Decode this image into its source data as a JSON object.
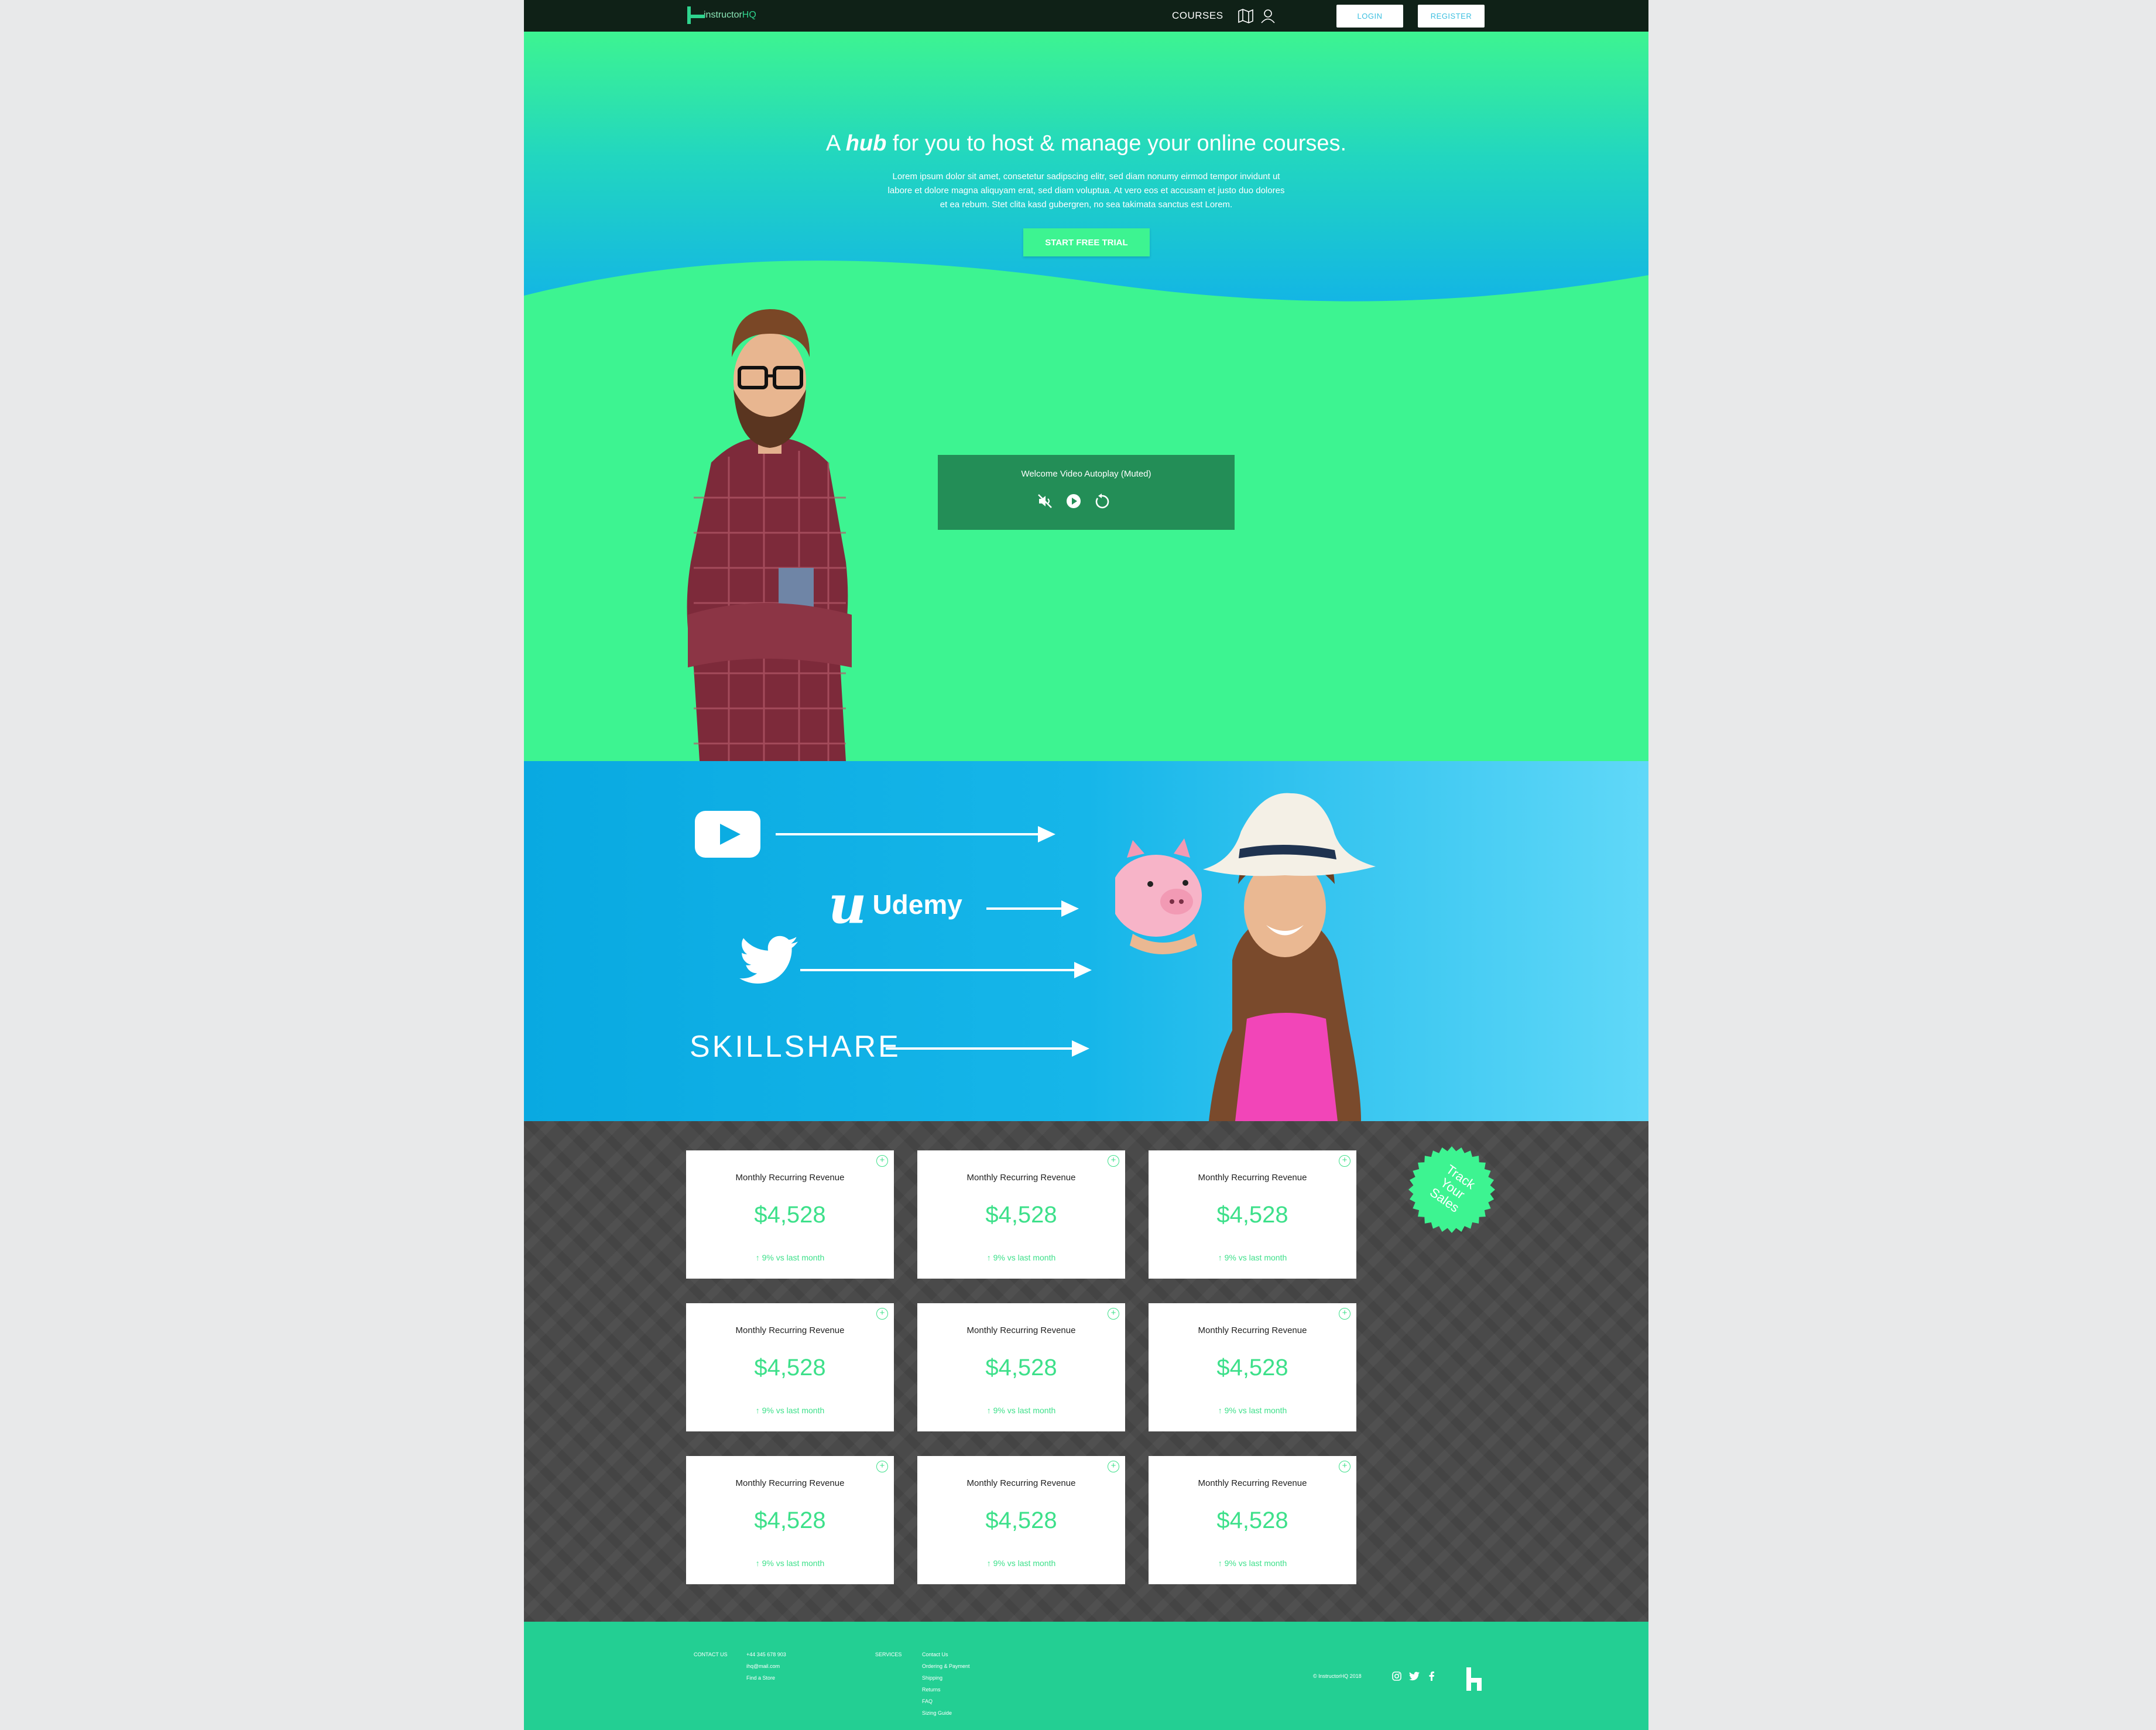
{
  "nav": {
    "logo_prefix": "instructor",
    "logo_suffix": "HQ",
    "courses": "COURSES",
    "login": "LOGIN",
    "register": "REGISTER"
  },
  "hero": {
    "title_pre": "A",
    "title_em": "hub",
    "title_post": "for you to host & manage your online courses.",
    "text": "Lorem ipsum dolor sit amet, consetetur sadipscing elitr, sed diam nonumy eirmod tempor invidunt ut labore et dolore magna aliquyam erat, sed diam voluptua. At vero eos et accusam et justo duo dolores et ea rebum. Stet clita kasd gubergren, no sea takimata sanctus est Lorem.",
    "cta": "START FREE TRIAL"
  },
  "video": {
    "title": "Welcome Video Autoplay (Muted)"
  },
  "platforms": {
    "udemy": "Udemy",
    "skillshare": "SKILLSHARE"
  },
  "cards": [
    {
      "title": "Monthly Recurring Revenue",
      "value": "$4,528",
      "change": "9% vs last month"
    },
    {
      "title": "Monthly Recurring Revenue",
      "value": "$4,528",
      "change": "9% vs last month"
    },
    {
      "title": "Monthly Recurring Revenue",
      "value": "$4,528",
      "change": "9% vs last month"
    },
    {
      "title": "Monthly Recurring Revenue",
      "value": "$4,528",
      "change": "9% vs last month"
    },
    {
      "title": "Monthly Recurring Revenue",
      "value": "$4,528",
      "change": "9% vs last month"
    },
    {
      "title": "Monthly Recurring Revenue",
      "value": "$4,528",
      "change": "9% vs last month"
    },
    {
      "title": "Monthly Recurring Revenue",
      "value": "$4,528",
      "change": "9% vs last month"
    },
    {
      "title": "Monthly Recurring Revenue",
      "value": "$4,528",
      "change": "9% vs last month"
    },
    {
      "title": "Monthly Recurring Revenue",
      "value": "$4,528",
      "change": "9% vs last month"
    }
  ],
  "badge": {
    "line1": "Track",
    "line2": "Your",
    "line3": "Sales"
  },
  "footer": {
    "contact_heading": "CONTACT US",
    "contact_items": [
      "+44 345 678 903",
      "ihq@mail.com",
      "Find a Store"
    ],
    "services_heading": "SERVICES",
    "services_items": [
      "Contact Us",
      "Ordering & Payment",
      "Shipping",
      "Returns",
      "FAQ",
      "Sizing Guide"
    ],
    "copyright": "© InstructorHQ 2018"
  },
  "colors": {
    "brand_green": "#3df491",
    "nav_bg": "#0f2117",
    "blue": "#09a9e1",
    "footer": "#23cf93",
    "video_box": "#238e57"
  }
}
